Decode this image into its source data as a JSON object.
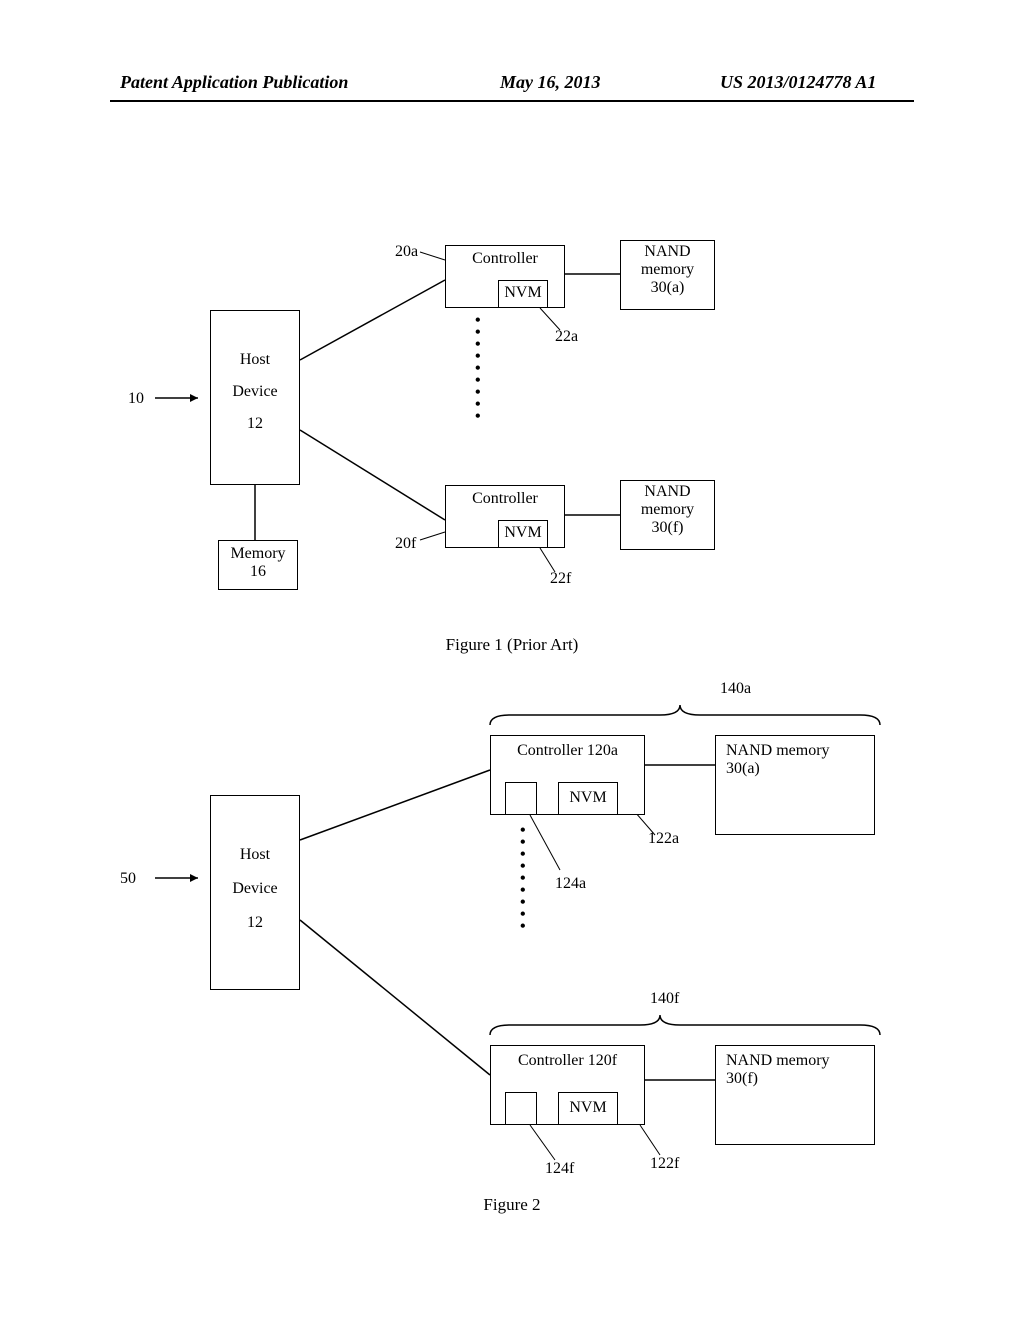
{
  "header": {
    "left": "Patent Application Publication",
    "center": "May 16, 2013",
    "right": "US 2013/0124778 A1"
  },
  "fig1": {
    "caption": "Figure 1 (Prior Art)",
    "hostTitle": "Host",
    "hostSub": "Device",
    "hostNum": "12",
    "memTitle": "Memory",
    "memNum": "16",
    "ctrlATitle": "Controller",
    "ctrlFTitle": "Controller",
    "nvmA": "NVM",
    "nvmF": "NVM",
    "nandATitle": "NAND",
    "nandASub": "memory",
    "nandANum": "30(a)",
    "nandFTitle": "NAND",
    "nandFSub": "memory",
    "nandFNum": "30(f)",
    "ref10": "10",
    "ref20a": "20a",
    "ref22a": "22a",
    "ref20f": "20f",
    "ref22f": "22f"
  },
  "fig2": {
    "caption": "Figure 2",
    "hostTitle": "Host",
    "hostSub": "Device",
    "hostNum": "12",
    "ctrlATitle": "Controller 120a",
    "ctrlFTitle": "Controller 120f",
    "nvmA": "NVM",
    "nvmF": "NVM",
    "nandATitle": "NAND memory",
    "nandANum": "30(a)",
    "nandFTitle": "NAND memory",
    "nandFNum": "30(f)",
    "ref50": "50",
    "ref140a": "140a",
    "ref140f": "140f",
    "ref122a": "122a",
    "ref124a": "124a",
    "ref122f": "122f",
    "ref124f": "124f"
  }
}
